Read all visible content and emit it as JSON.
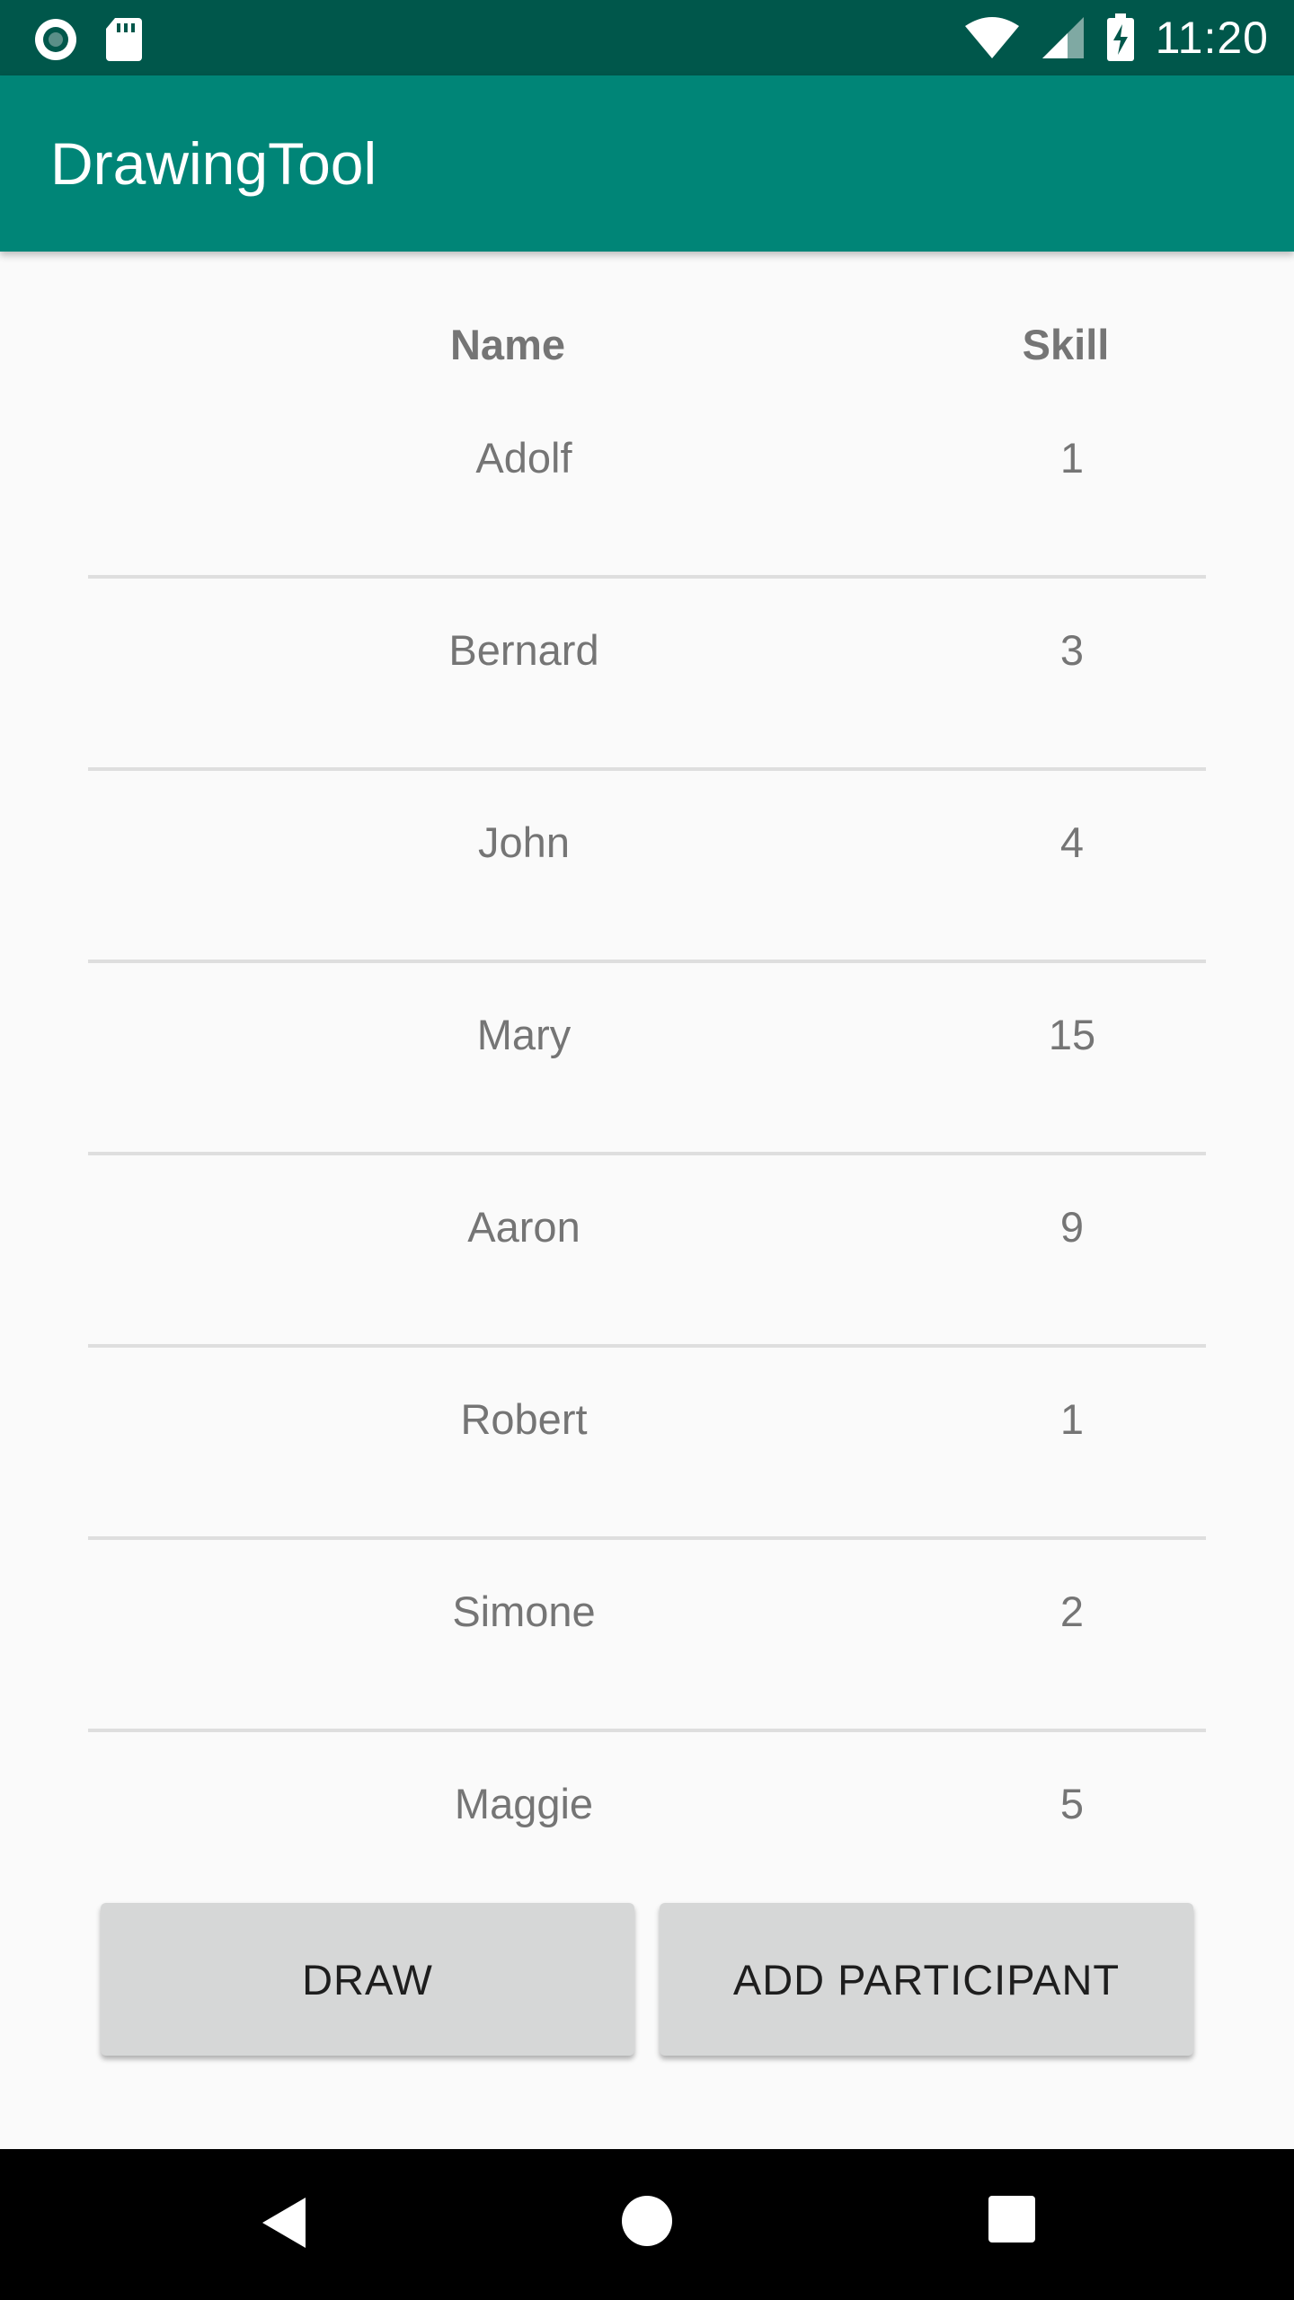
{
  "status_bar": {
    "time": "11:20",
    "icons": [
      "record-icon",
      "sd-card-icon",
      "wifi-icon",
      "signal-icon",
      "battery-charging-icon"
    ]
  },
  "app_bar": {
    "title": "DrawingTool"
  },
  "table": {
    "headers": {
      "name": "Name",
      "skill": "Skill"
    },
    "rows": [
      {
        "name": "Adolf",
        "skill": "1"
      },
      {
        "name": "Bernard",
        "skill": "3"
      },
      {
        "name": "John",
        "skill": "4"
      },
      {
        "name": "Mary",
        "skill": "15"
      },
      {
        "name": "Aaron",
        "skill": "9"
      },
      {
        "name": "Robert",
        "skill": "1"
      },
      {
        "name": "Simone",
        "skill": "2"
      },
      {
        "name": "Maggie",
        "skill": "5"
      }
    ]
  },
  "buttons": {
    "draw": "DRAW",
    "add_participant": "ADD PARTICIPANT"
  },
  "nav_bar": {
    "icons": [
      "back-icon",
      "home-icon",
      "recents-icon"
    ]
  },
  "colors": {
    "status_bar": "#00574b",
    "app_bar": "#008577",
    "button": "#d6d7d7"
  }
}
